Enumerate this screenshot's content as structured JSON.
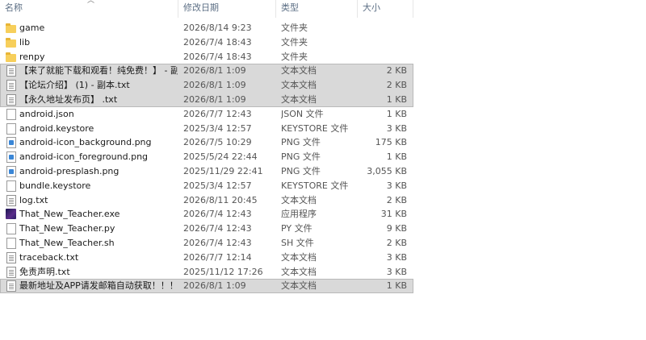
{
  "columns": {
    "name": "名称",
    "date": "修改日期",
    "type": "类型",
    "size": "大小"
  },
  "files": [
    {
      "icon": "folder-icon",
      "kind": "folder",
      "name": "game",
      "date": "2026/8/14 9:23",
      "type": "文件夹",
      "size": "",
      "selected": false
    },
    {
      "icon": "folder-icon",
      "kind": "folder",
      "name": "lib",
      "date": "2026/7/4 18:43",
      "type": "文件夹",
      "size": "",
      "selected": false
    },
    {
      "icon": "folder-icon",
      "kind": "folder",
      "name": "renpy",
      "date": "2026/7/4 18:43",
      "type": "文件夹",
      "size": "",
      "selected": false
    },
    {
      "icon": "text-document-icon",
      "kind": "txt",
      "name": "【来了就能下载和观看！纯免费！】 - 副...",
      "date": "2026/8/1 1:09",
      "type": "文本文档",
      "size": "2 KB",
      "selected": true
    },
    {
      "icon": "text-document-icon",
      "kind": "txt",
      "name": "【论坛介绍】 (1) - 副本.txt",
      "date": "2026/8/1 1:09",
      "type": "文本文档",
      "size": "2 KB",
      "selected": true
    },
    {
      "icon": "text-document-icon",
      "kind": "txt",
      "name": "【永久地址发布页】 .txt",
      "date": "2026/8/1 1:09",
      "type": "文本文档",
      "size": "1 KB",
      "selected": true
    },
    {
      "icon": "file-icon",
      "kind": "file",
      "name": "android.json",
      "date": "2026/7/7 12:43",
      "type": "JSON 文件",
      "size": "1 KB",
      "selected": false
    },
    {
      "icon": "file-icon",
      "kind": "file",
      "name": "android.keystore",
      "date": "2025/3/4 12:57",
      "type": "KEYSTORE 文件",
      "size": "3 KB",
      "selected": false
    },
    {
      "icon": "image-file-icon",
      "kind": "png",
      "name": "android-icon_background.png",
      "date": "2026/7/5 10:29",
      "type": "PNG 文件",
      "size": "175 KB",
      "selected": false
    },
    {
      "icon": "image-file-icon",
      "kind": "png",
      "name": "android-icon_foreground.png",
      "date": "2025/5/24 22:44",
      "type": "PNG 文件",
      "size": "1 KB",
      "selected": false
    },
    {
      "icon": "image-file-icon",
      "kind": "png",
      "name": "android-presplash.png",
      "date": "2025/11/29 22:41",
      "type": "PNG 文件",
      "size": "3,055 KB",
      "selected": false
    },
    {
      "icon": "file-icon",
      "kind": "file",
      "name": "bundle.keystore",
      "date": "2025/3/4 12:57",
      "type": "KEYSTORE 文件",
      "size": "3 KB",
      "selected": false
    },
    {
      "icon": "text-document-icon",
      "kind": "txt",
      "name": "log.txt",
      "date": "2026/8/11 20:45",
      "type": "文本文档",
      "size": "2 KB",
      "selected": false
    },
    {
      "icon": "application-icon",
      "kind": "exe",
      "name": "That_New_Teacher.exe",
      "date": "2026/7/4 12:43",
      "type": "应用程序",
      "size": "31 KB",
      "selected": false
    },
    {
      "icon": "file-icon",
      "kind": "file",
      "name": "That_New_Teacher.py",
      "date": "2026/7/4 12:43",
      "type": "PY 文件",
      "size": "9 KB",
      "selected": false
    },
    {
      "icon": "file-icon",
      "kind": "file",
      "name": "That_New_Teacher.sh",
      "date": "2026/7/4 12:43",
      "type": "SH 文件",
      "size": "2 KB",
      "selected": false
    },
    {
      "icon": "text-document-icon",
      "kind": "txt",
      "name": "traceback.txt",
      "date": "2026/7/7 12:14",
      "type": "文本文档",
      "size": "3 KB",
      "selected": false
    },
    {
      "icon": "text-document-icon",
      "kind": "txt",
      "name": "免责声明.txt",
      "date": "2025/11/12 17:26",
      "type": "文本文档",
      "size": "3 KB",
      "selected": false
    },
    {
      "icon": "text-document-icon",
      "kind": "txt",
      "name": "最新地址及APP请发邮箱自动获取！！！...",
      "date": "2026/8/1 1:09",
      "type": "文本文档",
      "size": "1 KB",
      "selected": true
    }
  ]
}
